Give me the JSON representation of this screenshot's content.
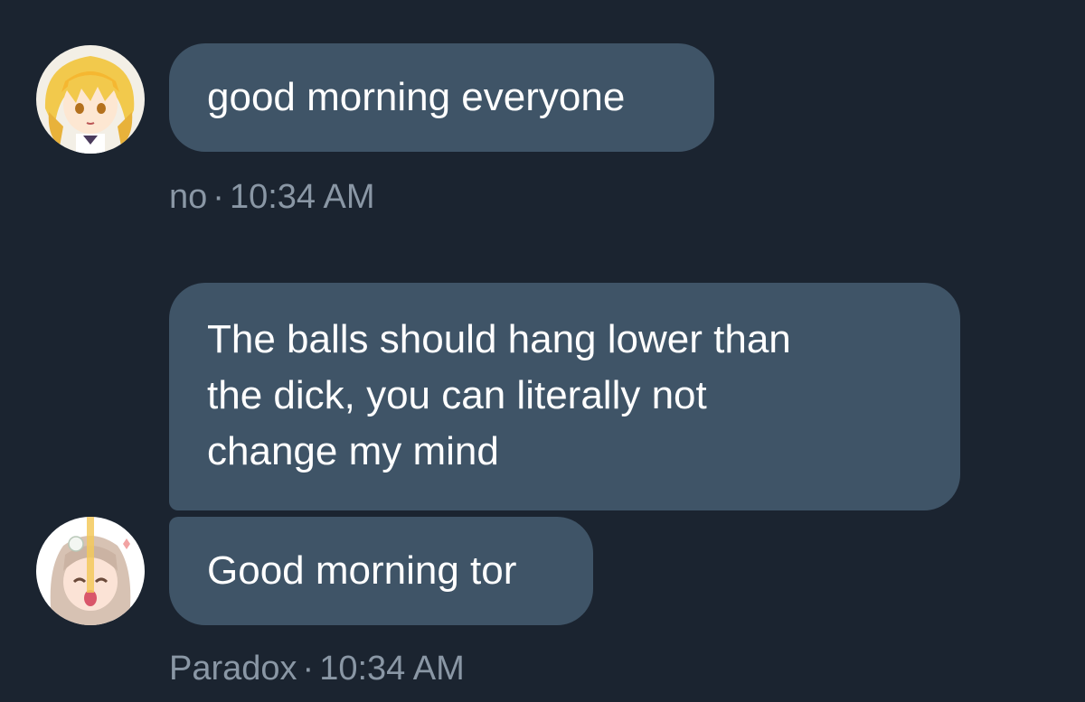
{
  "conversation": {
    "groups": [
      {
        "avatar": "blonde-anime-avatar",
        "messages": [
          "good morning everyone"
        ],
        "author": "no",
        "separator": "·",
        "time": "10:34 AM"
      },
      {
        "avatar": "anime-girl-avatar",
        "messages": [
          "The balls should hang lower than the dick, you can literally not change my mind",
          "Good morning tor"
        ],
        "author": "Paradox",
        "separator": "·",
        "time": "10:34 AM"
      }
    ]
  },
  "message_lines": {
    "m1": [
      "good morning everyone"
    ],
    "m2": [
      "The balls should hang lower than",
      "the dick, you can literally not",
      "change my mind"
    ],
    "m3": [
      "Good morning tor"
    ]
  },
  "colors": {
    "background": "#1b2430",
    "bubble": "#3f5467",
    "message_text": "#ffffff",
    "meta_text": "#8a97a5"
  }
}
